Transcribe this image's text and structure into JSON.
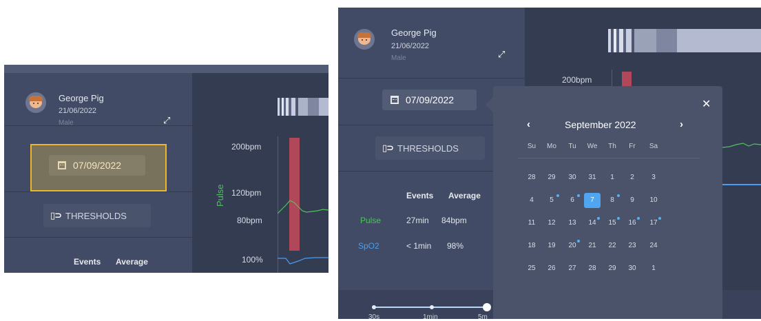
{
  "patient": {
    "name": "George Pig",
    "dob": "21/06/2022",
    "sex": "Male"
  },
  "date_button": {
    "label": "07/09/2022"
  },
  "thresholds_button": {
    "label": "THRESHOLDS",
    "icon": "thresholds-icon"
  },
  "stats": {
    "headers": [
      "Events",
      "Average"
    ],
    "rows": [
      {
        "label": "Pulse",
        "events": "27min",
        "average": "84bpm",
        "color": "#4ec45a"
      },
      {
        "label": "SpO2",
        "events": "< 1min",
        "average": "98%",
        "color": "#4a9df0"
      }
    ]
  },
  "chart": {
    "pulse_axis_label": "Pulse",
    "ticks": [
      "200bpm",
      "120bpm",
      "80bpm",
      "100%"
    ],
    "pulse_color": "#4ec45a",
    "spo2_color": "#4a9df0",
    "event_color": "#b0485a"
  },
  "calendar": {
    "month_label": "September 2022",
    "prev_icon": "chevron-left-icon",
    "next_icon": "chevron-right-icon",
    "close_icon": "close-icon",
    "weekdays": [
      "Su",
      "Mo",
      "Tu",
      "We",
      "Th",
      "Fr",
      "Sa"
    ],
    "weeks": [
      [
        "28",
        "29",
        "30",
        "31",
        "1",
        "2",
        "3"
      ],
      [
        "4",
        "5",
        "6",
        "7",
        "8",
        "9",
        "10"
      ],
      [
        "11",
        "12",
        "13",
        "14",
        "15",
        "16",
        "17"
      ],
      [
        "18",
        "19",
        "20",
        "21",
        "22",
        "23",
        "24"
      ],
      [
        "25",
        "26",
        "27",
        "28",
        "29",
        "30",
        "1"
      ]
    ],
    "selected_day": "7",
    "days_with_events": [
      "5",
      "6",
      "8",
      "14",
      "15",
      "16",
      "17",
      "20"
    ]
  },
  "time_range": {
    "labels": [
      "30s",
      "1min",
      "5m"
    ]
  }
}
